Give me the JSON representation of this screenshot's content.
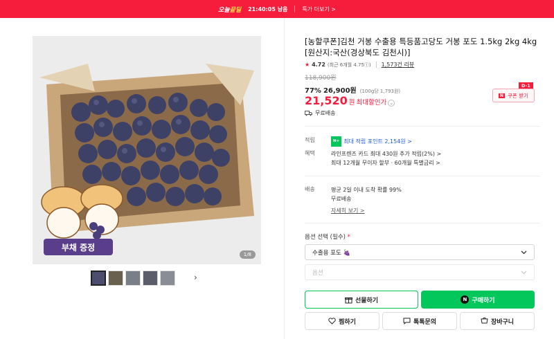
{
  "topbar": {
    "brand_prefix": "오늘",
    "brand_highlight": "끝딜",
    "timer": "21:40:05 남음",
    "more": "특가 더보기 >"
  },
  "gallery": {
    "badge": "부채 증정",
    "counter": "1/8"
  },
  "product": {
    "title": "[농할쿠폰]김천 거봉 수출용 특등품고당도 거봉 포도 1.5kg 2kg 4kg [원산지:국산(경상북도 김천시)]",
    "rating": "4.72",
    "rating_sub": "(최근 6개월 4.75ⓘ)",
    "reviews": "1,573건 리뷰",
    "original_price": "118,900원",
    "discount_pct": "77%",
    "sale_price": "26,900원",
    "unit_price": "(100g당 1,793원)",
    "best_price": "21,520",
    "best_price_suffix": "원",
    "best_label": "최대할인가",
    "free_shipping": "무료배송"
  },
  "coupon": {
    "dday": "D-1",
    "label": "쿠폰 받기",
    "icon": "N"
  },
  "benefits": {
    "points_key": "적립",
    "npay": "N+",
    "points_value": "최대 적립 포인트 2,154원 >",
    "perks_key": "혜택",
    "perk1": "라인프렌즈 카드 최대 430원 추가 적립(2%) >",
    "perk2": "최대 12개월 무이자 할부 · 60개월 특별금리 >",
    "delivery_key": "배송",
    "delivery1": "평균 2일 이내 도착 확률 99%",
    "delivery2": "무료배송",
    "details": "자세히 보기 >"
  },
  "options": {
    "label": "옵션 선택 (필수)",
    "required_mark": "*",
    "selected": "수출용 포도 🍇",
    "placeholder": "옵션"
  },
  "actions": {
    "gift": "선물하기",
    "buy": "구매하기",
    "wish": "찜하기",
    "talk": "톡톡문의",
    "cart": "장바구니"
  },
  "colors": {
    "brand_red": "#f51c3c",
    "naver_green": "#03c75a"
  }
}
